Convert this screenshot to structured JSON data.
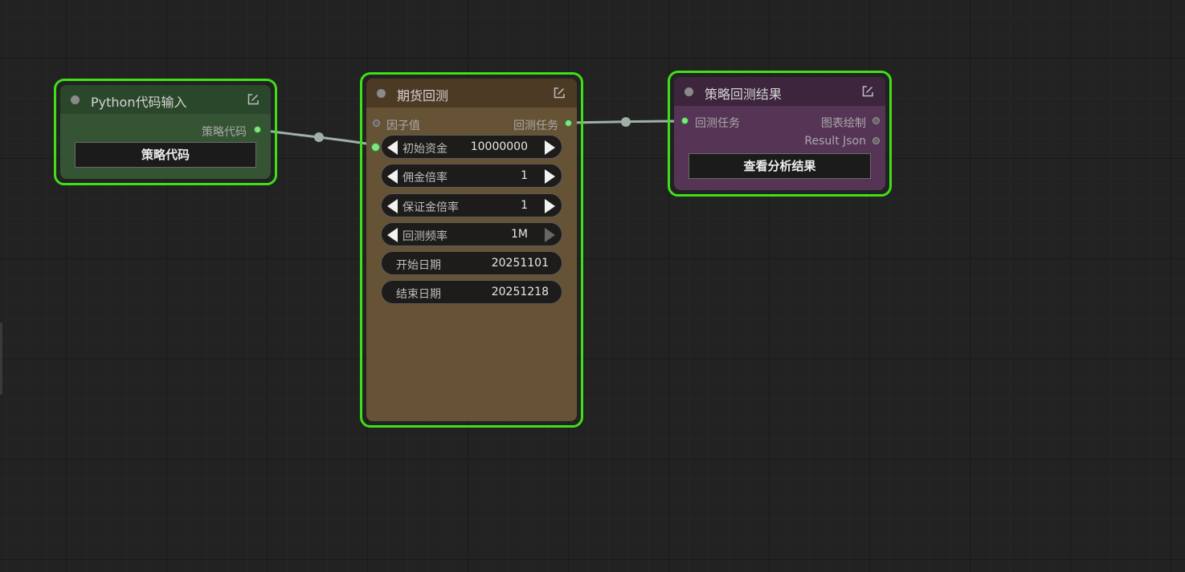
{
  "nodes": {
    "python_input": {
      "title": "Python代码输入",
      "outputs": [
        "策略代码"
      ],
      "button_label": "策略代码",
      "colors": {
        "body": "#345434",
        "title": "#2b472b"
      }
    },
    "futures_backtest": {
      "title": "期货回测",
      "inputs": [
        "因子值"
      ],
      "outputs": [
        "回测任务"
      ],
      "widgets": [
        {
          "label": "初始资金",
          "value": "10000000",
          "type": "number"
        },
        {
          "label": "佣金倍率",
          "value": "1",
          "type": "number"
        },
        {
          "label": "保证金倍率",
          "value": "1",
          "type": "number"
        },
        {
          "label": "回测频率",
          "value": "1M",
          "type": "combo"
        },
        {
          "label": "开始日期",
          "value": "20251101",
          "type": "text"
        },
        {
          "label": "结束日期",
          "value": "20251218",
          "type": "text"
        }
      ],
      "colors": {
        "body": "#665335",
        "title": "#4d3a25"
      }
    },
    "strategy_result": {
      "title": "策略回测结果",
      "inputs": [
        "回测任务"
      ],
      "outputs": [
        "图表绘制",
        "Result Json"
      ],
      "button_label": "查看分析结果",
      "colors": {
        "body": "#553455",
        "title": "#3d253d"
      }
    }
  },
  "colors": {
    "canvas_bg": "#222222",
    "selection": "#3fe017",
    "link": "#9fb1a6",
    "connected_slot": "#7fe77f"
  },
  "icons": [
    "edit-icon",
    "triangle-left-icon",
    "triangle-right-icon"
  ]
}
